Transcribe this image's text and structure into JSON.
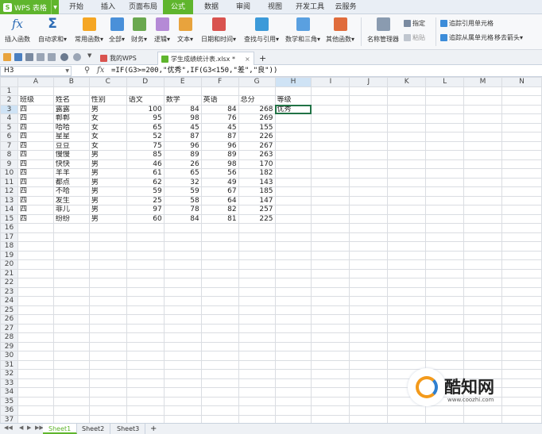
{
  "app": {
    "name": "WPS 表格"
  },
  "menu_tabs": [
    {
      "label": "开始"
    },
    {
      "label": "插入"
    },
    {
      "label": "页面布局"
    },
    {
      "label": "公式"
    },
    {
      "label": "数据"
    },
    {
      "label": "审阅"
    },
    {
      "label": "视图"
    },
    {
      "label": "开发工具"
    },
    {
      "label": "云服务"
    }
  ],
  "active_menu_tab": "公式",
  "ribbon": {
    "insert_function": "插入函数",
    "autosum": "自动求和",
    "common_functions": "常用函数",
    "all": "全部",
    "financial": "财务",
    "logical": "逻辑",
    "text": "文本",
    "datetime": "日期和时间",
    "lookup": "查找与引用",
    "math": "数学和三角",
    "other": "其他函数",
    "name_manager": "名称管理器",
    "specify": "指定",
    "paste": "粘贴",
    "trace_precedents": "追踪引用单元格",
    "trace_dependents": "追踪从属单元格",
    "remove_arrows": "移去箭头"
  },
  "doc_tabs": [
    {
      "label": "我的WPS",
      "active": false
    },
    {
      "label": "学生成绩统计表.xlsx *",
      "active": true
    }
  ],
  "formula_bar": {
    "cell_ref": "H3",
    "fx": "fx",
    "formula": "=IF(G3>=200,\"优秀\",IF(G3<150,\"差\",\"良\"))"
  },
  "grid": {
    "columns": [
      "A",
      "B",
      "C",
      "D",
      "E",
      "F",
      "G",
      "H",
      "I",
      "J",
      "K",
      "L",
      "M",
      "N"
    ],
    "first_row": 1,
    "row_count": 37,
    "selected_cell": "H3",
    "rows": {
      "2": [
        "班级",
        "姓名",
        "性别",
        "语文",
        "数学",
        "英语",
        "总分",
        "等级"
      ],
      "3": [
        "四",
        "露露",
        "男",
        100,
        84,
        84,
        268,
        "优秀"
      ],
      "4": [
        "四",
        "郸郸",
        "女",
        95,
        98,
        76,
        269,
        ""
      ],
      "5": [
        "四",
        "哈哈",
        "女",
        65,
        45,
        45,
        155,
        ""
      ],
      "6": [
        "四",
        "星星",
        "女",
        52,
        87,
        87,
        226,
        ""
      ],
      "7": [
        "四",
        "豆豆",
        "女",
        75,
        96,
        96,
        267,
        ""
      ],
      "8": [
        "四",
        "慢慢",
        "男",
        85,
        89,
        89,
        263,
        ""
      ],
      "9": [
        "四",
        "快快",
        "男",
        46,
        26,
        98,
        170,
        ""
      ],
      "10": [
        "四",
        "羊羊",
        "男",
        61,
        65,
        56,
        182,
        ""
      ],
      "11": [
        "四",
        "都点",
        "男",
        62,
        32,
        49,
        143,
        ""
      ],
      "12": [
        "四",
        "不哈",
        "男",
        59,
        59,
        67,
        185,
        ""
      ],
      "13": [
        "四",
        "发生",
        "男",
        25,
        58,
        64,
        147,
        ""
      ],
      "14": [
        "四",
        "菲儿",
        "男",
        97,
        78,
        82,
        257,
        ""
      ],
      "15": [
        "四",
        "纷纷",
        "男",
        60,
        84,
        81,
        225,
        ""
      ]
    }
  },
  "sheets": [
    {
      "label": "Sheet1",
      "active": true
    },
    {
      "label": "Sheet2",
      "active": false
    },
    {
      "label": "Sheet3",
      "active": false
    }
  ],
  "add_sheet": "+",
  "watermark": {
    "title": "酷知网",
    "url": "www.coozhi.com"
  },
  "colors": {
    "accent": "#5fb52d",
    "selection": "#217346"
  }
}
